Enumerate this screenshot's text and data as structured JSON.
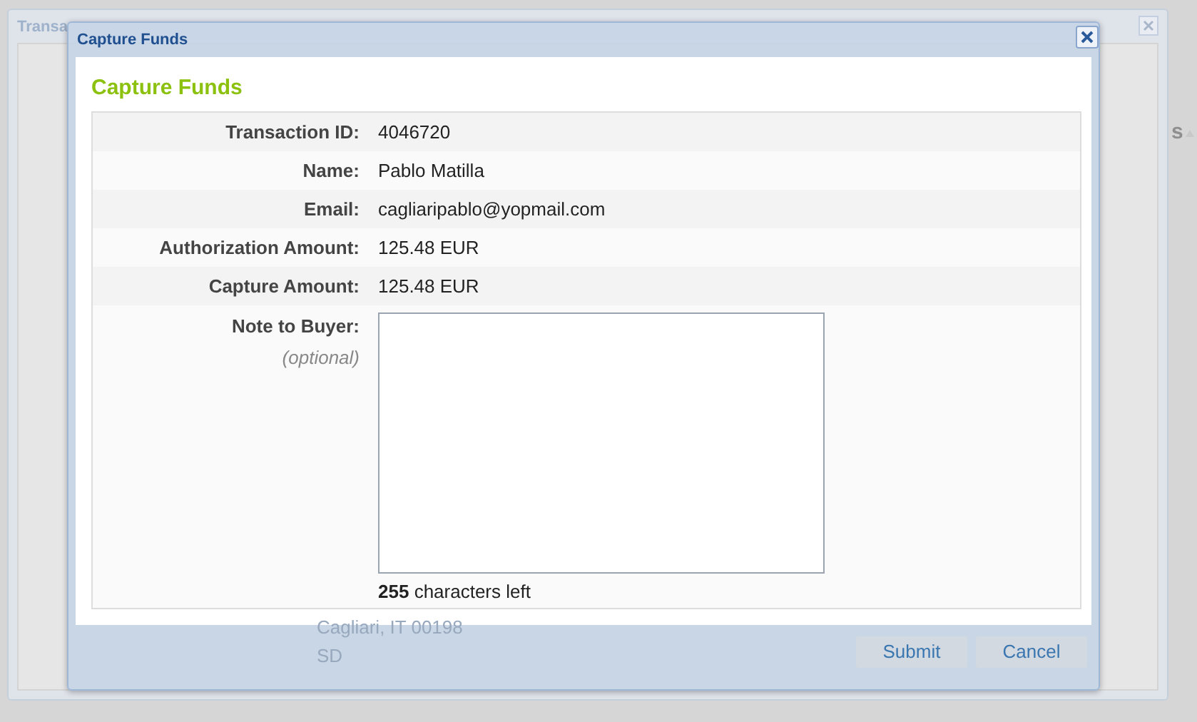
{
  "background_window": {
    "title": "Transa",
    "address_lines": [
      "Cagliari, IT 00198",
      "SD"
    ]
  },
  "background_page": {
    "column_header": "s"
  },
  "dialog": {
    "title": "Capture Funds",
    "heading": "Capture Funds",
    "fields": [
      {
        "label": "Transaction ID:",
        "value": "4046720"
      },
      {
        "label": "Name:",
        "value": "Pablo Matilla"
      },
      {
        "label": "Email:",
        "value": "cagliaripablo@yopmail.com"
      },
      {
        "label": "Authorization Amount:",
        "value": "125.48 EUR"
      },
      {
        "label": "Capture Amount:",
        "value": "125.48 EUR"
      }
    ],
    "note": {
      "label": "Note to Buyer:",
      "hint": "(optional)",
      "counter": "**255** characters left"
    },
    "buttons": [
      "Submit",
      "Cancel"
    ]
  }
}
